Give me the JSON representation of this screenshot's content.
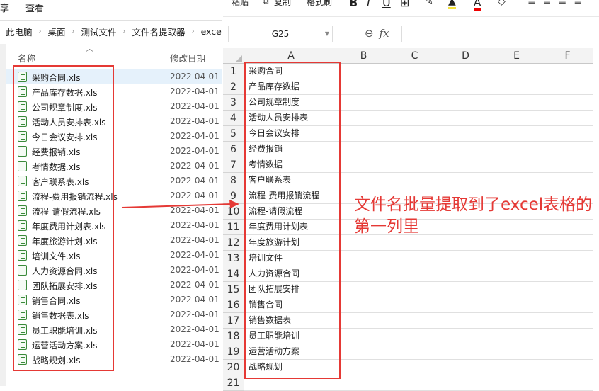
{
  "explorer": {
    "menu": [
      "享",
      "查看"
    ],
    "breadcrumb": [
      "此电脑",
      "桌面",
      "测试文件",
      "文件名提取器",
      "exce"
    ],
    "columns": {
      "name": "名称",
      "date": "修改日期"
    },
    "files": [
      {
        "name": "采购合同.xls",
        "date": "2022-04-01"
      },
      {
        "name": "产品库存数据.xls",
        "date": "2022-04-01"
      },
      {
        "name": "公司规章制度.xls",
        "date": "2022-04-01"
      },
      {
        "name": "活动人员安排表.xls",
        "date": "2022-04-01"
      },
      {
        "name": "今日会议安排.xls",
        "date": "2022-04-01"
      },
      {
        "name": "经费报销.xls",
        "date": "2022-04-01"
      },
      {
        "name": "考情数据.xls",
        "date": "2022-04-01"
      },
      {
        "name": "客户联系表.xls",
        "date": "2022-04-01"
      },
      {
        "name": "流程-费用报销流程.xls",
        "date": "2022-04-01"
      },
      {
        "name": "流程-请假流程.xls",
        "date": "2022-04-01"
      },
      {
        "name": "年度费用计划表.xls",
        "date": "2022-04-01"
      },
      {
        "name": "年度旅游计划.xls",
        "date": "2022-04-01"
      },
      {
        "name": "培训文件.xls",
        "date": "2022-04-01"
      },
      {
        "name": "人力资源合同.xls",
        "date": "2022-04-01"
      },
      {
        "name": "团队拓展安排.xls",
        "date": "2022-04-01"
      },
      {
        "name": "销售合同.xls",
        "date": "2022-04-01"
      },
      {
        "name": "销售数据表.xls",
        "date": "2022-04-01"
      },
      {
        "name": "员工职能培训.xls",
        "date": "2022-04-01"
      },
      {
        "name": "运营活动方案.xls",
        "date": "2022-04-01"
      },
      {
        "name": "战略规划.xls",
        "date": "2022-04-01"
      }
    ]
  },
  "excel": {
    "ribbon": {
      "paste": "粘贴",
      "copy": "复制",
      "format_painter": "格式刷"
    },
    "name_box": "G25",
    "columns": [
      "A",
      "B",
      "C",
      "D",
      "E",
      "F"
    ],
    "rows": [
      "采购合同",
      "产品库存数据",
      "公司规章制度",
      "活动人员安排表",
      "今日会议安排",
      "经费报销",
      "考情数据",
      "客户联系表",
      "流程-费用报销流程",
      "流程-请假流程",
      "年度费用计划表",
      "年度旅游计划",
      "培训文件",
      "人力资源合同",
      "团队拓展安排",
      "销售合同",
      "销售数据表",
      "员工职能培训",
      "运营活动方案",
      "战略规划",
      ""
    ]
  },
  "annotation": "文件名批量提取到了excel表格的第一列里",
  "colors": {
    "highlight": "#e53935"
  }
}
